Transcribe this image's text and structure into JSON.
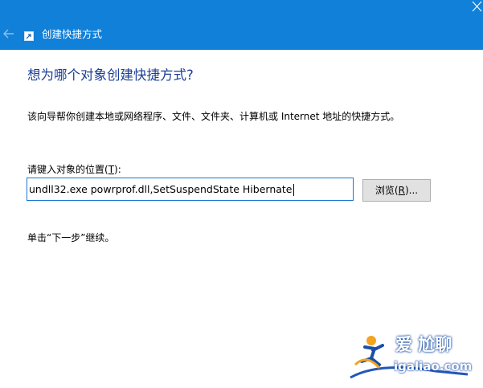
{
  "window": {
    "title": "创建快捷方式"
  },
  "page": {
    "heading": "想为哪个对象创建快捷方式?",
    "description": "该向导帮你创建本地或网络程序、文件、文件夹、计算机或 Internet 地址的快捷方式。",
    "location_label_prefix": "请键入对象的位置(",
    "location_label_accel": "T",
    "location_label_suffix": "):",
    "location_value": "undll32.exe powrprof.dll,SetSuspendState Hibernate",
    "browse_prefix": "浏览(",
    "browse_accel": "R",
    "browse_suffix": ")...",
    "hint": "单击“下一步”继续。"
  },
  "watermark": {
    "brand_cn": "爱 尬聊",
    "brand_domain": "igaliao.com"
  },
  "colors": {
    "titlebar": "#1180d8",
    "heading": "#1c3f94",
    "input_border": "#1b76d0",
    "button_bg": "#e1e1e1"
  },
  "icons": {
    "back": "back-arrow-icon",
    "title": "shortcut-wizard-icon",
    "close": "close-icon"
  }
}
